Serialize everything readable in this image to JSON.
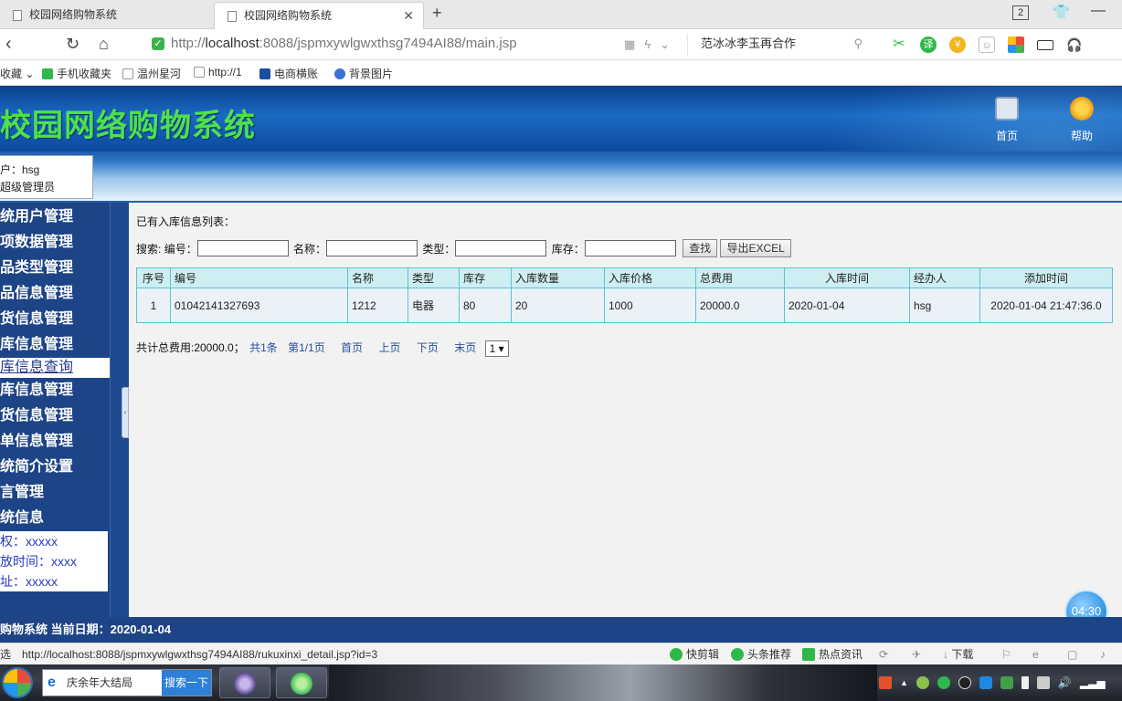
{
  "browser": {
    "tabs": [
      {
        "title": "校园网络购物系统",
        "active": false
      },
      {
        "title": "校园网络购物系统",
        "active": true
      }
    ],
    "window_count": "2",
    "url_prefix": "http://",
    "url_host": "localhost",
    "url_rest": ":8088/jspmxywlgwxthsg7494AI88/main.jsp",
    "search_text": "范冰冰李玉再合作",
    "bookmarks": [
      "收藏",
      "手机收藏夹",
      "温州星河",
      "http://1",
      "电商横账",
      "背景图片"
    ]
  },
  "site": {
    "title": "校园网络购物系统",
    "header_links": [
      {
        "label": "首页",
        "icon": "home-icon"
      },
      {
        "label": "帮助",
        "icon": "help-icon"
      }
    ],
    "user_line1": "户：hsg",
    "user_line2": "超级管理员"
  },
  "sidebar": {
    "items": [
      "统用户管理",
      "项数据管理",
      "品类型管理",
      "品信息管理",
      "货信息管理",
      "库信息管理",
      "库信息查询",
      "库信息管理",
      "货信息管理",
      "单信息管理",
      "统简介设置",
      "言管理",
      "统信息"
    ],
    "active_index": 6,
    "info": [
      "权：xxxxx",
      "放时间：xxxx",
      "址：xxxxx"
    ]
  },
  "main": {
    "list_title": "已有入库信息列表：",
    "search": {
      "prefix": "搜索:",
      "field_labels": [
        "编号：",
        "名称：",
        "类型：",
        "库存："
      ],
      "find_button": "查找",
      "export_button": "导出EXCEL"
    },
    "table": {
      "columns": [
        "序号",
        "编号",
        "名称",
        "类型",
        "库存",
        "入库数量",
        "入库价格",
        "总费用",
        "入库时间",
        "经办人",
        "添加时间"
      ],
      "rows": [
        [
          "1",
          "01042141327693",
          "1212",
          "电器",
          "80",
          "20",
          "1000",
          "20000.0",
          "2020-01-04",
          "hsg",
          "2020-01-04 21:47:36.0"
        ]
      ]
    },
    "pager": {
      "total_cost": "共计总费用:20000.0；",
      "count": "共1条",
      "page_info": "第1/1页",
      "first": "首页",
      "prev": "上页",
      "next": "下页",
      "last": "末页",
      "page_select": "1"
    }
  },
  "timer": "04:30",
  "footer": "购物系统 当前日期：2020-01-04",
  "statusbar": {
    "left": "选",
    "link_url": "http://localhost:8088/jspmxywlgwxthsg7494AI88/rukuxinxi_detail.jsp?id=3",
    "items": [
      "快剪辑",
      "头条推荐",
      "热点资讯",
      "下载"
    ]
  },
  "taskbar": {
    "search_text": "庆余年大结局",
    "search_button": "搜索一下"
  }
}
